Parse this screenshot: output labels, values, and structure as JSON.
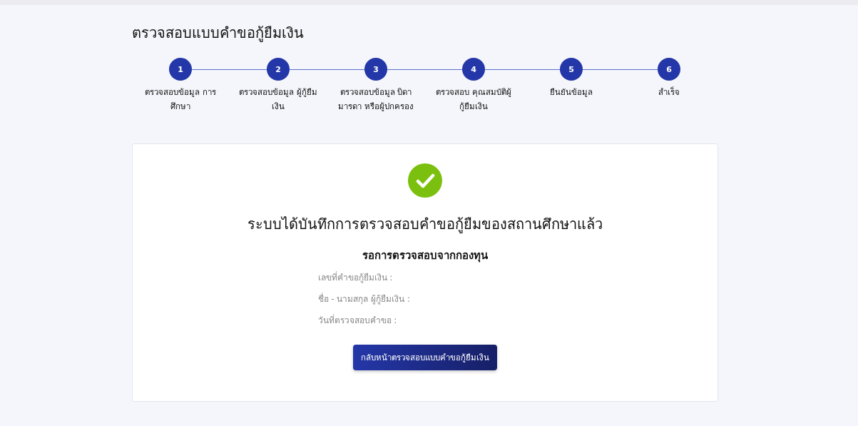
{
  "page_title": "ตรวจสอบแบบคำขอกู้ยืมเงิน",
  "steps": [
    {
      "number": "1",
      "label": "ตรวจสอบข้อมูล การศึกษา"
    },
    {
      "number": "2",
      "label": "ตรวจสอบข้อมูล ผู้กู้ยืมเงิน"
    },
    {
      "number": "3",
      "label": "ตรวจสอบข้อมูล บิดา มารดา หรือผู้ปกครอง"
    },
    {
      "number": "4",
      "label": "ตรวจสอบ คุณสมบัติผู้กู้ยืมเงิน"
    },
    {
      "number": "5",
      "label": "ยืนยันข้อมูล"
    },
    {
      "number": "6",
      "label": "สำเร็จ"
    }
  ],
  "result": {
    "heading": "ระบบได้บันทึกการตรวจสอบคำขอกู้ยืมของสถานศึกษาแล้ว",
    "status": "รอการตรวจสอบจากกองทุน",
    "fields": [
      "เลขที่คำขอกู้ยืมเงิน :",
      "ชื่อ - นามสกุล ผู้กู้ยืมเงิน :",
      "วันที่ตรวจสอบคำขอ :"
    ],
    "button": "กลับหน้าตรวจสอบแบบคำขอกู้ยืมเงิน"
  }
}
